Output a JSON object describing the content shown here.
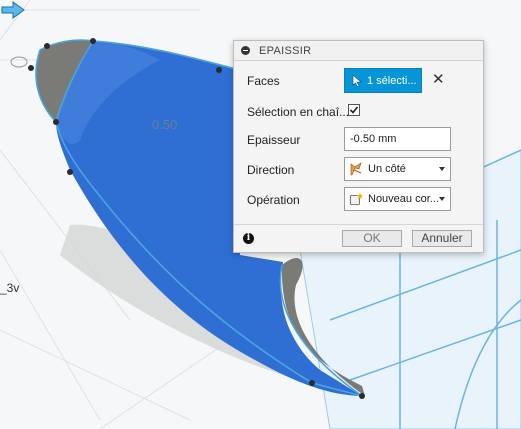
{
  "viewport": {
    "dimension_label": "0.50",
    "side_label": "_3v"
  },
  "dialog": {
    "title": "EPAISSIR",
    "faces": {
      "label": "Faces",
      "button_label": "1 sélecti..."
    },
    "chain_selection": {
      "label": "Sélection en chaî...",
      "checked": true
    },
    "thickness": {
      "label": "Epaisseur",
      "value": "-0.50 mm"
    },
    "direction": {
      "label": "Direction",
      "value": "Un côté"
    },
    "operation": {
      "label": "Opération",
      "value": "Nouveau cor..."
    },
    "ok_label": "OK",
    "cancel_label": "Annuler"
  },
  "colors": {
    "accent": "#0696d7",
    "surface_blue": "#2f6fd3",
    "surface_grey": "#7a7a76"
  }
}
